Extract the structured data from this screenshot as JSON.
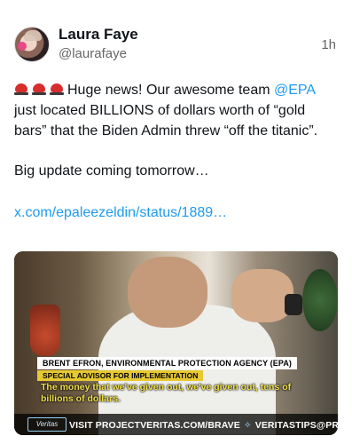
{
  "author": {
    "name": "Laura Faye",
    "handle": "@laurafaye",
    "time": "1h"
  },
  "post": {
    "line_start": "Huge news! Our awesome team ",
    "mention": "@EPA",
    "line_rest": " just located BILLIONS of dollars worth of “gold bars” that the Biden Admin threw “off the titanic”.",
    "paragraph2": "Big update coming tomorrow…",
    "link": "x.com/epaleezeldin/status/1889…"
  },
  "video": {
    "name_label": "BRENT EFRON, ENVIRONMENTAL PROTECTION AGENCY (EPA)",
    "role_label": "SPECIAL ADVISOR FOR IMPLEMENTATION",
    "caption": "The money that we've given out, we've given out, tens of billions of dollars.",
    "footer_visit": "VISIT PROJECTVERITAS.COM/BRAVE",
    "footer_email": "VERITASTIPS@PROTONMAIL.COM",
    "logo_text": "Veritas"
  }
}
